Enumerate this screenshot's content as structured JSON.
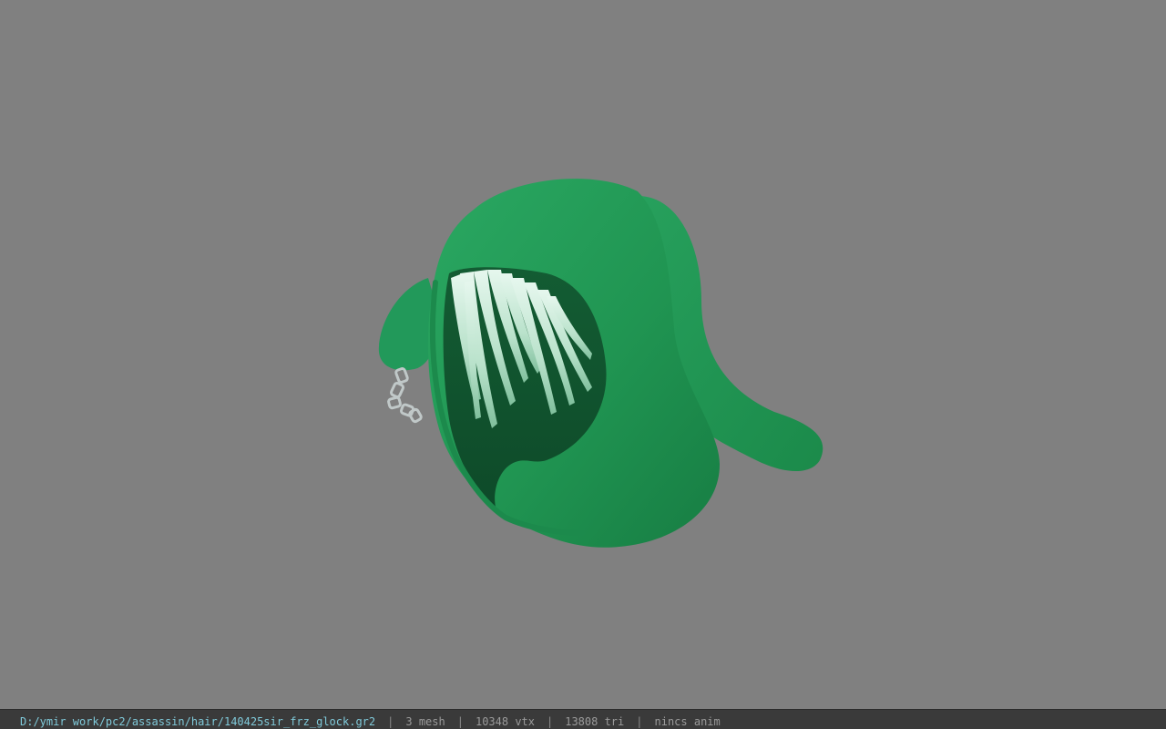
{
  "viewer": {
    "background_color": "#808080",
    "model": {
      "hood_color": "#219a55",
      "hair_color": "#c8ecd8",
      "chain_color": "#c0c8c8"
    }
  },
  "statusbar": {
    "file_path": "D:/ymir work/pc2/assassin/hair/140425sir_frz_glock.gr2",
    "separator": "|",
    "mesh_count": "3 mesh",
    "vertex_count": "10348 vtx",
    "triangle_count": "13808 tri",
    "anim_status": "nincs anim"
  }
}
